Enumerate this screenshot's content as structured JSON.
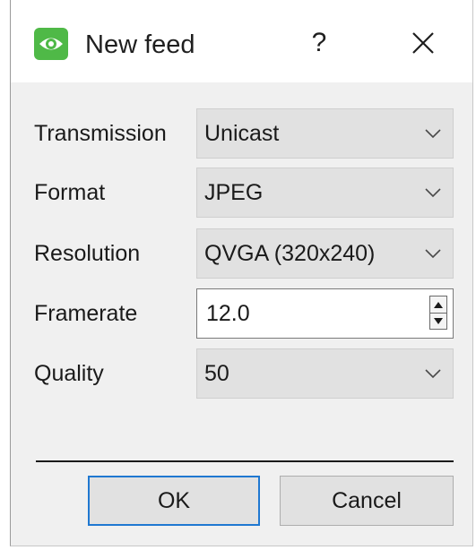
{
  "window": {
    "title": "New feed",
    "help_label": "?",
    "icons": {
      "app": "eye-icon",
      "close": "close-icon"
    }
  },
  "form": {
    "transmission": {
      "label": "Transmission",
      "value": "Unicast"
    },
    "format": {
      "label": "Format",
      "value": "JPEG"
    },
    "resolution": {
      "label": "Resolution",
      "value": "QVGA (320x240)"
    },
    "framerate": {
      "label": "Framerate",
      "value": "12.0"
    },
    "quality": {
      "label": "Quality",
      "value": "50"
    }
  },
  "buttons": {
    "ok": "OK",
    "cancel": "Cancel"
  },
  "colors": {
    "accent": "#1f78d1",
    "app_icon": "#4fb947",
    "dialog_bg": "#f0f0f0",
    "combo_bg": "#e1e1e1"
  }
}
